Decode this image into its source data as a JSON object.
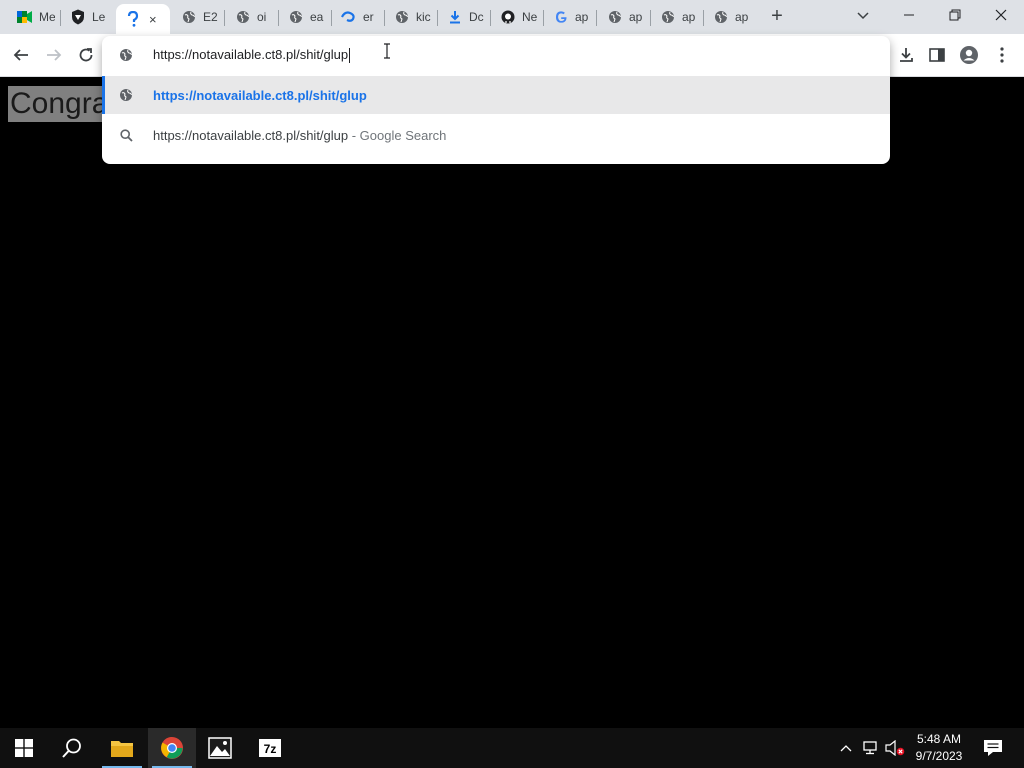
{
  "browser": {
    "tabs": [
      {
        "label": "Me",
        "icon": "google-meet-icon"
      },
      {
        "label": "Le",
        "icon": "shield-icon"
      },
      {
        "label": "",
        "icon": "question-icon",
        "active": true,
        "close": "×"
      },
      {
        "label": "E2",
        "icon": "globe-icon"
      },
      {
        "label": "oi",
        "icon": "globe-icon"
      },
      {
        "label": "ea",
        "icon": "globe-icon"
      },
      {
        "label": "er",
        "icon": "swirl-icon"
      },
      {
        "label": "kic",
        "icon": "globe-icon"
      },
      {
        "label": "Dc",
        "icon": "download-icon"
      },
      {
        "label": "Ne",
        "icon": "github-icon"
      },
      {
        "label": "ap",
        "icon": "google-icon"
      },
      {
        "label": "ap",
        "icon": "globe-icon"
      },
      {
        "label": "ap",
        "icon": "globe-icon"
      },
      {
        "label": "ap",
        "icon": "globe-icon"
      }
    ],
    "new_tab": "+"
  },
  "omnibox": {
    "input_text": "https://notavailable.ct8.pl/shit/glup",
    "suggestion_url": "https://notavailable.ct8.pl/shit/glup",
    "search_query": "https://notavailable.ct8.pl/shit/glup",
    "search_hint": " - Google Search"
  },
  "page": {
    "heading": "Congratulations"
  },
  "taskbar": {
    "time": "5:48 AM",
    "date": "9/7/2023"
  },
  "colors": {
    "accent": "#1a73e8",
    "tabstrip": "#dee1e6",
    "taskbar": "#101010"
  }
}
